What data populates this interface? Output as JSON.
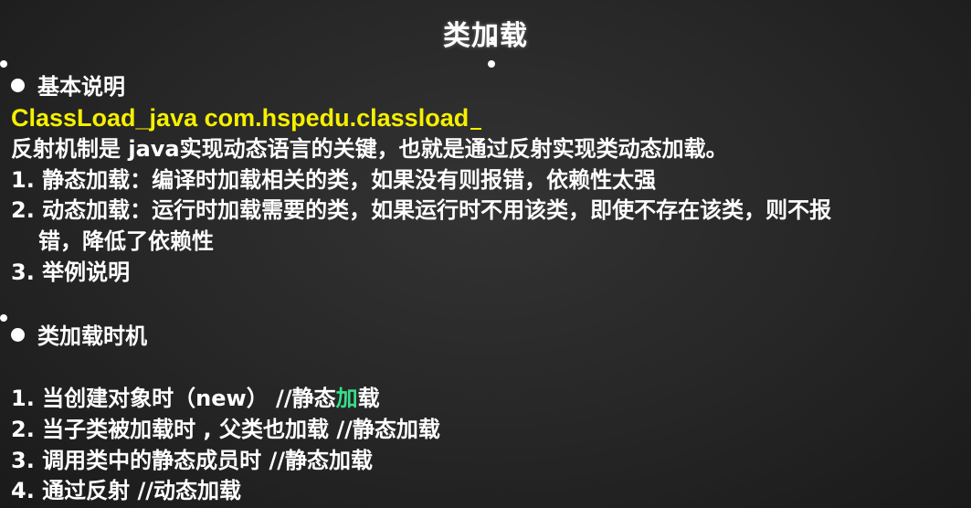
{
  "title": "类加载",
  "section1": {
    "heading": "基本说明",
    "code_line": "ClassLoad_java com.hspedu.classload",
    "intro": "反射机制是 java实现动态语言的关键，也就是通过反射实现类动态加载。",
    "items": [
      "1. 静态加载：编译时加载相关的类，如果没有则报错，依赖性太强",
      "2. 动态加载：运行时加载需要的类，如果运行时不用该类，即使不存在该类，则不报",
      "错，降低了依赖性",
      "3. 举例说明"
    ]
  },
  "section2": {
    "heading": "类加载时机",
    "item1": {
      "prefix": "1. 当创建对象时（new） //静态",
      "highlight": "加",
      "suffix": "载"
    },
    "items": [
      "2. 当子类被加载时 , 父类也加载 //静态加载",
      "3. 调用类中的静态成员时 //静态加载",
      "4. 通过反射 //动态加载"
    ]
  },
  "colors": {
    "background": "#262626",
    "text": "#ffffff",
    "accent_yellow": "#f5f000",
    "highlight_green": "#35e08a"
  }
}
